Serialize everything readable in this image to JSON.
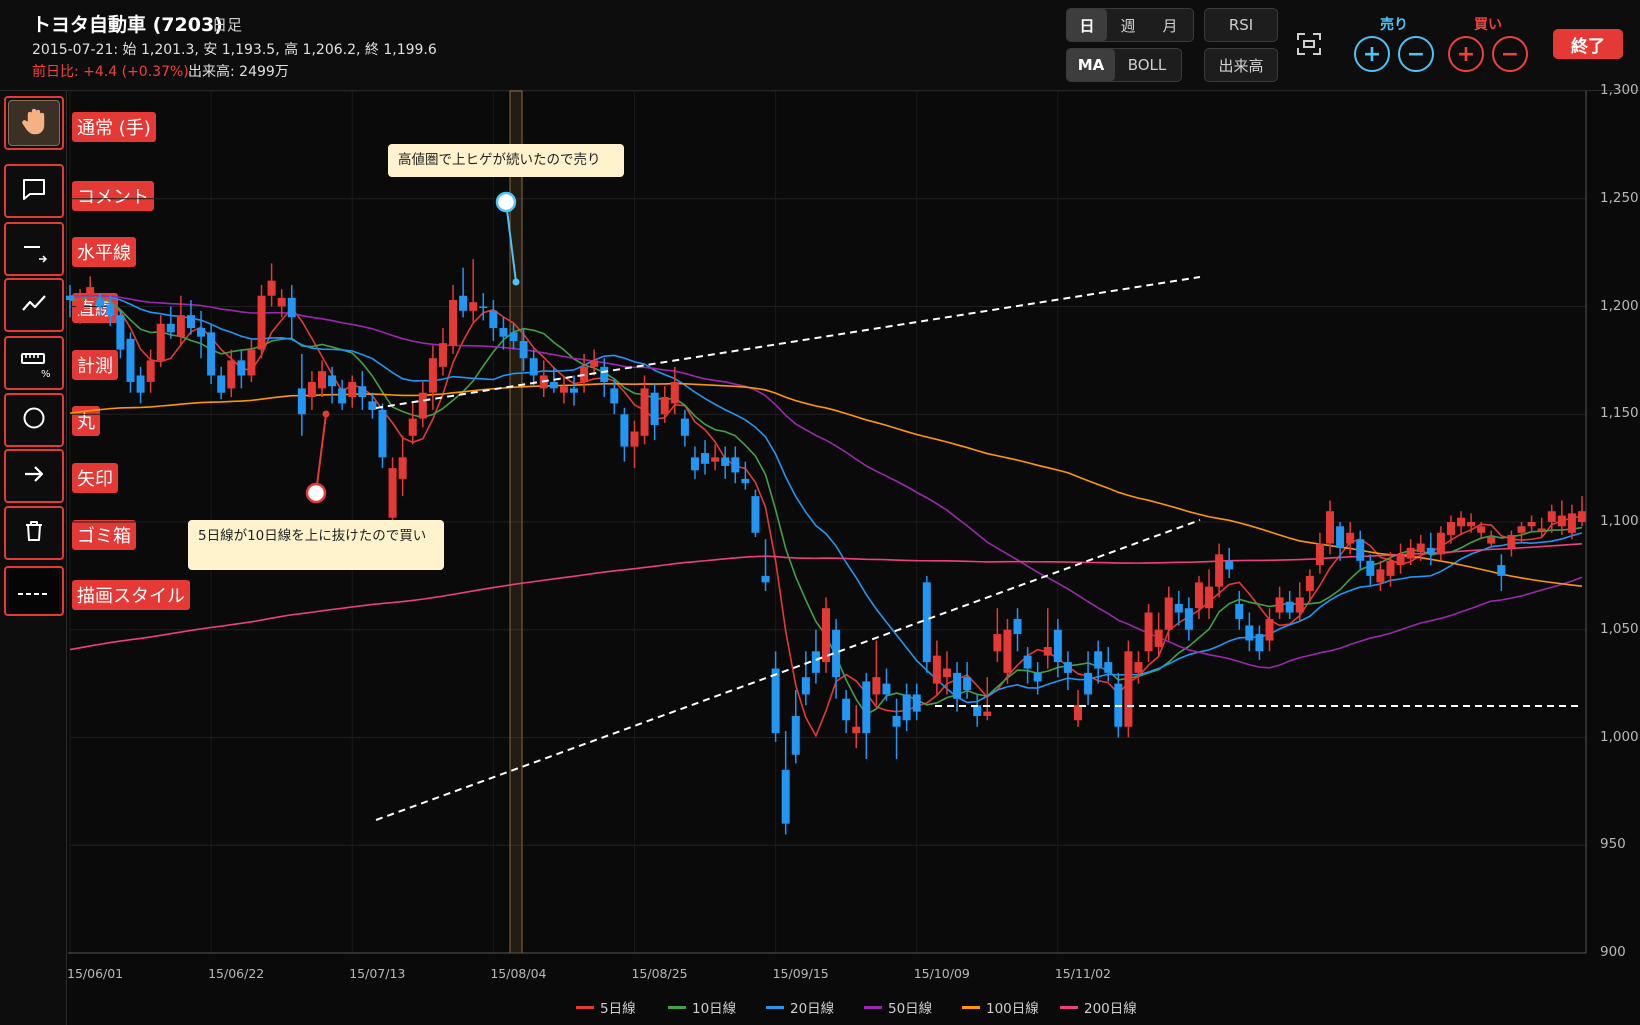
{
  "header": {
    "title": "トヨタ自動車 (7203)",
    "timeframe": "日足",
    "ohlc": "2015-07-21: 始 1,201.3, 安 1,193.5, 高 1,206.2, 終 1,199.6",
    "change": "前日比: +4.4 (+0.37%)",
    "volume": "出来高: 2499万"
  },
  "controls": {
    "period": [
      "日",
      "週",
      "月"
    ],
    "period_selected": "日",
    "rsi": "RSI",
    "overlay": [
      "MA",
      "BOLL"
    ],
    "overlay_selected": "MA",
    "volume_btn": "出来高",
    "sell_label": "売り",
    "buy_label": "買い",
    "plus": "+",
    "minus": "−",
    "end": "終了"
  },
  "tools": [
    {
      "label": "通常 (手)",
      "icon": "hand-icon"
    },
    {
      "label": "コメント",
      "icon": "comment-icon"
    },
    {
      "label": "水平線",
      "icon": "horizontal-line-icon"
    },
    {
      "label": "直線",
      "icon": "trend-line-icon"
    },
    {
      "label": "計測",
      "icon": "ruler-icon"
    },
    {
      "label": "丸",
      "icon": "circle-icon"
    },
    {
      "label": "矢印",
      "icon": "arrow-icon"
    },
    {
      "label": "ゴミ箱",
      "icon": "trash-icon"
    },
    {
      "label": "描画スタイル",
      "icon": "dash-style-icon"
    }
  ],
  "comments": [
    "高値圏で上ヒゲが続いたので売り",
    "5日線が10日線を上に抜けたので買い"
  ],
  "chart_data": {
    "type": "candlestick",
    "y_ticks": [
      "1,300",
      "1,250",
      "1,200",
      "1,150",
      "1,100",
      "1,050",
      "1,000",
      "950",
      "900"
    ],
    "ylim": [
      900,
      1300
    ],
    "x_ticks": [
      "15/06/01",
      "15/06/22",
      "15/07/13",
      "15/08/04",
      "15/08/25",
      "15/09/15",
      "15/10/09",
      "15/11/02"
    ],
    "legend": [
      {
        "name": "5日線",
        "color": "#e53935"
      },
      {
        "name": "10日線",
        "color": "#43a047"
      },
      {
        "name": "20日線",
        "color": "#2196f3"
      },
      {
        "name": "50日線",
        "color": "#9c27b0"
      },
      {
        "name": "100日線",
        "color": "#ff9800"
      },
      {
        "name": "200日線",
        "color": "#ec407a"
      }
    ],
    "candles": [
      [
        1205,
        1203,
        1210,
        1195
      ],
      [
        1198,
        1203,
        1208,
        1192
      ],
      [
        1206,
        1209,
        1214,
        1203
      ],
      [
        1203,
        1200,
        1206,
        1196
      ],
      [
        1201,
        1196,
        1205,
        1191
      ],
      [
        1196,
        1180,
        1198,
        1176
      ],
      [
        1185,
        1165,
        1188,
        1160
      ],
      [
        1168,
        1160,
        1172,
        1155
      ],
      [
        1165,
        1175,
        1180,
        1160
      ],
      [
        1175,
        1192,
        1196,
        1172
      ],
      [
        1192,
        1188,
        1200,
        1185
      ],
      [
        1186,
        1196,
        1205,
        1182
      ],
      [
        1196,
        1190,
        1203,
        1187
      ],
      [
        1190,
        1186,
        1198,
        1176
      ],
      [
        1188,
        1168,
        1192,
        1164
      ],
      [
        1168,
        1160,
        1172,
        1157
      ],
      [
        1162,
        1175,
        1180,
        1158
      ],
      [
        1175,
        1168,
        1180,
        1162
      ],
      [
        1168,
        1180,
        1185,
        1165
      ],
      [
        1180,
        1205,
        1210,
        1176
      ],
      [
        1205,
        1212,
        1220,
        1200
      ],
      [
        1200,
        1204,
        1208,
        1195
      ],
      [
        1204,
        1195,
        1210,
        1185
      ],
      [
        1162,
        1150,
        1178,
        1140
      ],
      [
        1158,
        1165,
        1170,
        1152
      ],
      [
        1162,
        1170,
        1175,
        1158
      ],
      [
        1168,
        1163,
        1172,
        1155
      ],
      [
        1162,
        1155,
        1166,
        1152
      ],
      [
        1158,
        1165,
        1168,
        1153
      ],
      [
        1163,
        1158,
        1170,
        1152
      ],
      [
        1156,
        1152,
        1160,
        1148
      ],
      [
        1152,
        1130,
        1155,
        1125
      ],
      [
        1102,
        1125,
        1130,
        1097
      ],
      [
        1120,
        1130,
        1140,
        1112
      ],
      [
        1140,
        1148,
        1155,
        1136
      ],
      [
        1148,
        1160,
        1165,
        1144
      ],
      [
        1160,
        1176,
        1182,
        1152
      ],
      [
        1172,
        1183,
        1190,
        1168
      ],
      [
        1182,
        1203,
        1210,
        1178
      ],
      [
        1205,
        1198,
        1218,
        1195
      ],
      [
        1198,
        1202,
        1222,
        1193
      ],
      [
        1200,
        1199.6,
        1206.2,
        1193.5
      ],
      [
        1198,
        1190,
        1203,
        1184
      ],
      [
        1190,
        1186,
        1195,
        1180
      ],
      [
        1188,
        1184,
        1192,
        1180
      ],
      [
        1184,
        1176,
        1190,
        1170
      ],
      [
        1176,
        1168,
        1180,
        1163
      ],
      [
        1162,
        1168,
        1175,
        1158
      ],
      [
        1165,
        1162,
        1172,
        1160
      ],
      [
        1160,
        1163,
        1168,
        1155
      ],
      [
        1162,
        1160,
        1168,
        1154
      ],
      [
        1165,
        1172,
        1178,
        1160
      ],
      [
        1172,
        1175,
        1180,
        1168
      ],
      [
        1172,
        1165,
        1176,
        1158
      ],
      [
        1162,
        1155,
        1166,
        1150
      ],
      [
        1150,
        1135,
        1153,
        1128
      ],
      [
        1135,
        1142,
        1147,
        1125
      ],
      [
        1140,
        1162,
        1168,
        1136
      ],
      [
        1160,
        1145,
        1164,
        1138
      ],
      [
        1150,
        1158,
        1163,
        1146
      ],
      [
        1155,
        1165,
        1172,
        1150
      ],
      [
        1148,
        1140,
        1152,
        1135
      ],
      [
        1130,
        1124,
        1135,
        1120
      ],
      [
        1132,
        1127,
        1138,
        1122
      ],
      [
        1128,
        1130,
        1136,
        1124
      ],
      [
        1130,
        1126,
        1135,
        1120
      ],
      [
        1130,
        1123,
        1135,
        1118
      ],
      [
        1120,
        1118,
        1128,
        1115
      ],
      [
        1112,
        1095,
        1115,
        1093
      ],
      [
        1075,
        1072,
        1092,
        1068
      ],
      [
        1032,
        1002,
        1040,
        998
      ],
      [
        985,
        960,
        1003,
        955
      ],
      [
        1010,
        992,
        1022,
        988
      ],
      [
        1028,
        1020,
        1040,
        1015
      ],
      [
        1040,
        1030,
        1050,
        1025
      ],
      [
        1035,
        1060,
        1065,
        1030
      ],
      [
        1050,
        1028,
        1055,
        1018
      ],
      [
        1018,
        1008,
        1022,
        1002
      ],
      [
        1002,
        1005,
        1015,
        995
      ],
      [
        1026,
        1002,
        1030,
        990
      ],
      [
        1020,
        1028,
        1045,
        1015
      ],
      [
        1025,
        1020,
        1032,
        1017
      ],
      [
        1010,
        1005,
        1018,
        990
      ],
      [
        1020,
        1008,
        1025,
        1003
      ],
      [
        1020,
        1012,
        1025,
        1008
      ],
      [
        1072,
        1035,
        1075,
        1030
      ],
      [
        1025,
        1038,
        1045,
        1020
      ],
      [
        1028,
        1032,
        1040,
        1020
      ],
      [
        1030,
        1018,
        1035,
        1012
      ],
      [
        1028,
        1022,
        1035,
        1018
      ],
      [
        1015,
        1010,
        1020,
        1005
      ],
      [
        1010,
        1012,
        1028,
        1008
      ],
      [
        1040,
        1048,
        1060,
        1035
      ],
      [
        1030,
        1050,
        1055,
        1025
      ],
      [
        1055,
        1048,
        1060,
        1040
      ],
      [
        1038,
        1032,
        1042,
        1025
      ],
      [
        1030,
        1026,
        1035,
        1020
      ],
      [
        1038,
        1042,
        1060,
        1032
      ],
      [
        1050,
        1035,
        1055,
        1028
      ],
      [
        1035,
        1030,
        1040,
        1022
      ],
      [
        1008,
        1015,
        1022,
        1005
      ],
      [
        1030,
        1020,
        1040,
        1015
      ],
      [
        1040,
        1032,
        1045,
        1025
      ],
      [
        1035,
        1030,
        1042,
        1026
      ],
      [
        1025,
        1005,
        1030,
        1000
      ],
      [
        1005,
        1040,
        1045,
        1000
      ],
      [
        1030,
        1035,
        1040,
        1025
      ],
      [
        1040,
        1058,
        1062,
        1035
      ],
      [
        1042,
        1050,
        1058,
        1038
      ],
      [
        1050,
        1065,
        1070,
        1045
      ],
      [
        1062,
        1058,
        1068,
        1052
      ],
      [
        1060,
        1050,
        1065,
        1045
      ],
      [
        1060,
        1072,
        1075,
        1055
      ],
      [
        1060,
        1070,
        1078,
        1055
      ],
      [
        1070,
        1085,
        1090,
        1065
      ],
      [
        1082,
        1078,
        1088,
        1074
      ],
      [
        1062,
        1055,
        1068,
        1050
      ],
      [
        1052,
        1045,
        1058,
        1040
      ],
      [
        1048,
        1040,
        1052,
        1036
      ],
      [
        1045,
        1055,
        1060,
        1040
      ],
      [
        1058,
        1065,
        1070,
        1055
      ],
      [
        1063,
        1058,
        1068,
        1055
      ],
      [
        1058,
        1065,
        1072,
        1054
      ],
      [
        1068,
        1075,
        1078,
        1063
      ],
      [
        1080,
        1090,
        1095,
        1076
      ],
      [
        1090,
        1105,
        1110,
        1085
      ],
      [
        1098,
        1088,
        1100,
        1082
      ],
      [
        1090,
        1095,
        1100,
        1085
      ],
      [
        1092,
        1082,
        1096,
        1078
      ],
      [
        1082,
        1075,
        1085,
        1070
      ],
      [
        1072,
        1078,
        1082,
        1068
      ],
      [
        1075,
        1082,
        1086,
        1070
      ],
      [
        1080,
        1085,
        1090,
        1076
      ],
      [
        1083,
        1088,
        1092,
        1080
      ],
      [
        1086,
        1090,
        1094,
        1082
      ],
      [
        1088,
        1085,
        1095,
        1080
      ],
      [
        1085,
        1095,
        1098,
        1082
      ],
      [
        1094,
        1100,
        1103,
        1090
      ],
      [
        1098,
        1102,
        1105,
        1094
      ],
      [
        1098,
        1100,
        1104,
        1095
      ],
      [
        1095,
        1098,
        1100,
        1092
      ],
      [
        1090,
        1093,
        1096,
        1088
      ],
      [
        1080,
        1075,
        1085,
        1068
      ],
      [
        1088,
        1094,
        1096,
        1084
      ],
      [
        1095,
        1098,
        1100,
        1090
      ],
      [
        1098,
        1100,
        1103,
        1095
      ],
      [
        1096,
        1097,
        1102,
        1093
      ],
      [
        1100,
        1105,
        1108,
        1095
      ],
      [
        1098,
        1103,
        1110,
        1094
      ],
      [
        1095,
        1104,
        1108,
        1092
      ],
      [
        1100,
        1105,
        1112,
        1098
      ]
    ]
  }
}
